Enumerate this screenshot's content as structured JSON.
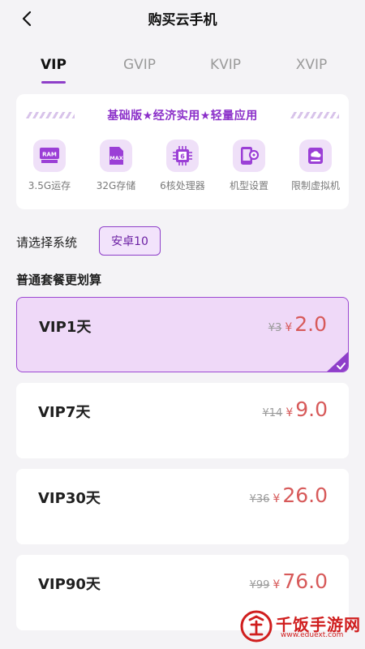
{
  "header": {
    "title": "购买云手机",
    "back_icon": "chevron-left-icon"
  },
  "tabs": [
    {
      "label": "VIP",
      "active": true
    },
    {
      "label": "GVIP",
      "active": false
    },
    {
      "label": "KVIP",
      "active": false
    },
    {
      "label": "XVIP",
      "active": false
    }
  ],
  "feature_banner": "基础版★经济实用★轻量应用",
  "features": [
    {
      "icon": "ram-icon",
      "icon_text": "RAM",
      "label": "3.5G运存"
    },
    {
      "icon": "storage-card-icon",
      "icon_text": "MAX",
      "label": "32G存储"
    },
    {
      "icon": "cpu-icon",
      "icon_text": "6",
      "label": "6核处理器"
    },
    {
      "icon": "phone-settings-icon",
      "icon_text": "",
      "label": "机型设置"
    },
    {
      "icon": "virtual-machine-icon",
      "icon_text": "",
      "label": "限制虚拟机"
    }
  ],
  "system": {
    "label": "请选择系统",
    "selected": "安卓10"
  },
  "plans_section_title": "普通套餐更划算",
  "plans": [
    {
      "name": "VIP1天",
      "original_price": "¥3",
      "currency": "¥",
      "price": "2.0",
      "selected": true
    },
    {
      "name": "VIP7天",
      "original_price": "¥14",
      "currency": "¥",
      "price": "9.0",
      "selected": false
    },
    {
      "name": "VIP30天",
      "original_price": "¥36",
      "currency": "¥",
      "price": "26.0",
      "selected": false
    },
    {
      "name": "VIP90天",
      "original_price": "¥99",
      "currency": "¥",
      "price": "76.0",
      "selected": false
    }
  ],
  "watermark": {
    "text": "千饭手游网",
    "url": "www.eduext.com"
  },
  "colors": {
    "accent": "#8e3fc9",
    "price": "#d75a5a",
    "selected_bg": "#efd9f8"
  }
}
